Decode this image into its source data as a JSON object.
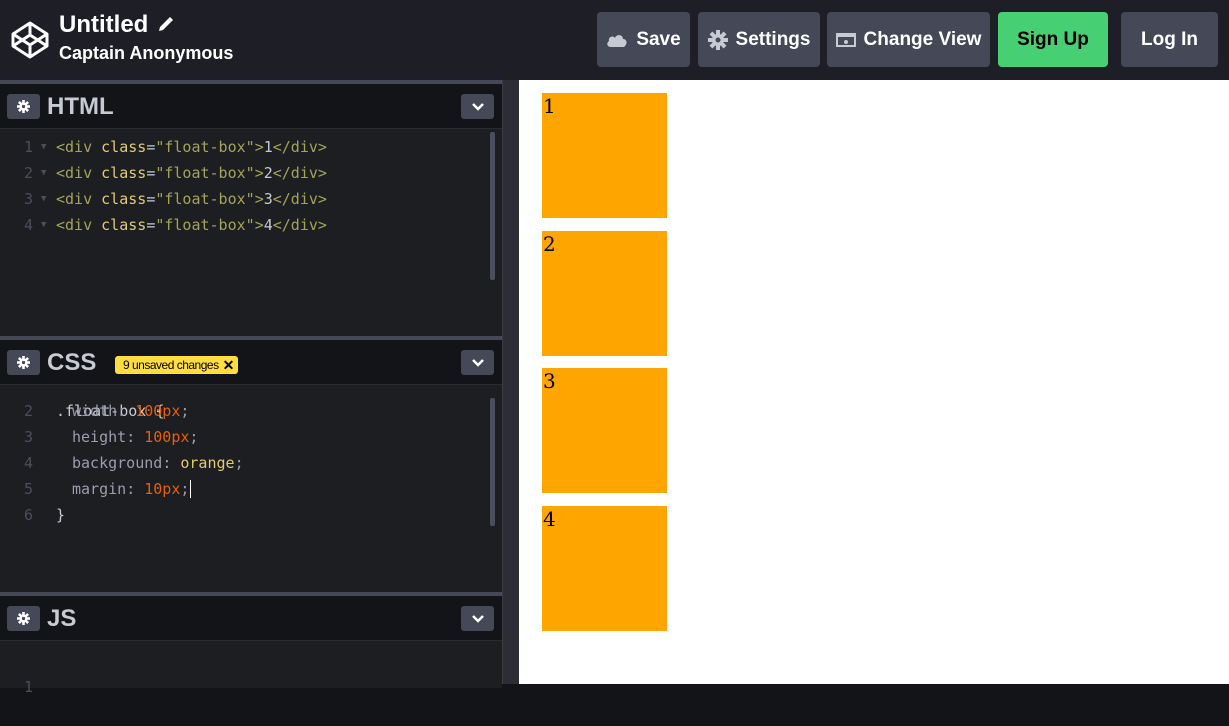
{
  "header": {
    "title": "Untitled",
    "author": "Captain Anonymous",
    "buttons": {
      "save": "Save",
      "settings": "Settings",
      "change_view": "Change View",
      "sign_up": "Sign Up",
      "log_in": "Log In"
    }
  },
  "colors": {
    "accent_green": "#47cf73",
    "badge_yellow": "#ffdd40",
    "preview_box": "#ffa500"
  },
  "panes": {
    "html": {
      "title": "HTML",
      "lines": [
        {
          "n": "1",
          "open": "<div ",
          "attr": "class",
          "eq": "=",
          "str": "\"float-box\"",
          "close": ">",
          "text": "1",
          "end": "</div>"
        },
        {
          "n": "2",
          "open": "<div ",
          "attr": "class",
          "eq": "=",
          "str": "\"float-box\"",
          "close": ">",
          "text": "2",
          "end": "</div>"
        },
        {
          "n": "3",
          "open": "<div ",
          "attr": "class",
          "eq": "=",
          "str": "\"float-box\"",
          "close": ">",
          "text": "3",
          "end": "</div>"
        },
        {
          "n": "4",
          "open": "<div ",
          "attr": "class",
          "eq": "=",
          "str": "\"float-box\"",
          "close": ">",
          "text": "4",
          "end": "</div>"
        }
      ]
    },
    "css": {
      "title": "CSS",
      "badge": "9 unsaved changes",
      "badge_close": "✕",
      "first_line": ".float-box {",
      "lines": [
        {
          "n": "2",
          "prop": "width",
          "colon": ": ",
          "val": "100px",
          "semi": ";"
        },
        {
          "n": "3",
          "prop": "height",
          "colon": ": ",
          "val": "100px",
          "semi": ";"
        },
        {
          "n": "4",
          "prop": "background",
          "colon": ": ",
          "val": "orange",
          "semi": ";"
        },
        {
          "n": "5",
          "prop": "margin",
          "colon": ": ",
          "val": "10px",
          "semi": ";"
        }
      ],
      "last_n": "6",
      "last_line": "}"
    },
    "js": {
      "title": "JS",
      "line_n": "1"
    }
  },
  "preview": {
    "boxes": [
      "1",
      "2",
      "3",
      "4"
    ]
  }
}
